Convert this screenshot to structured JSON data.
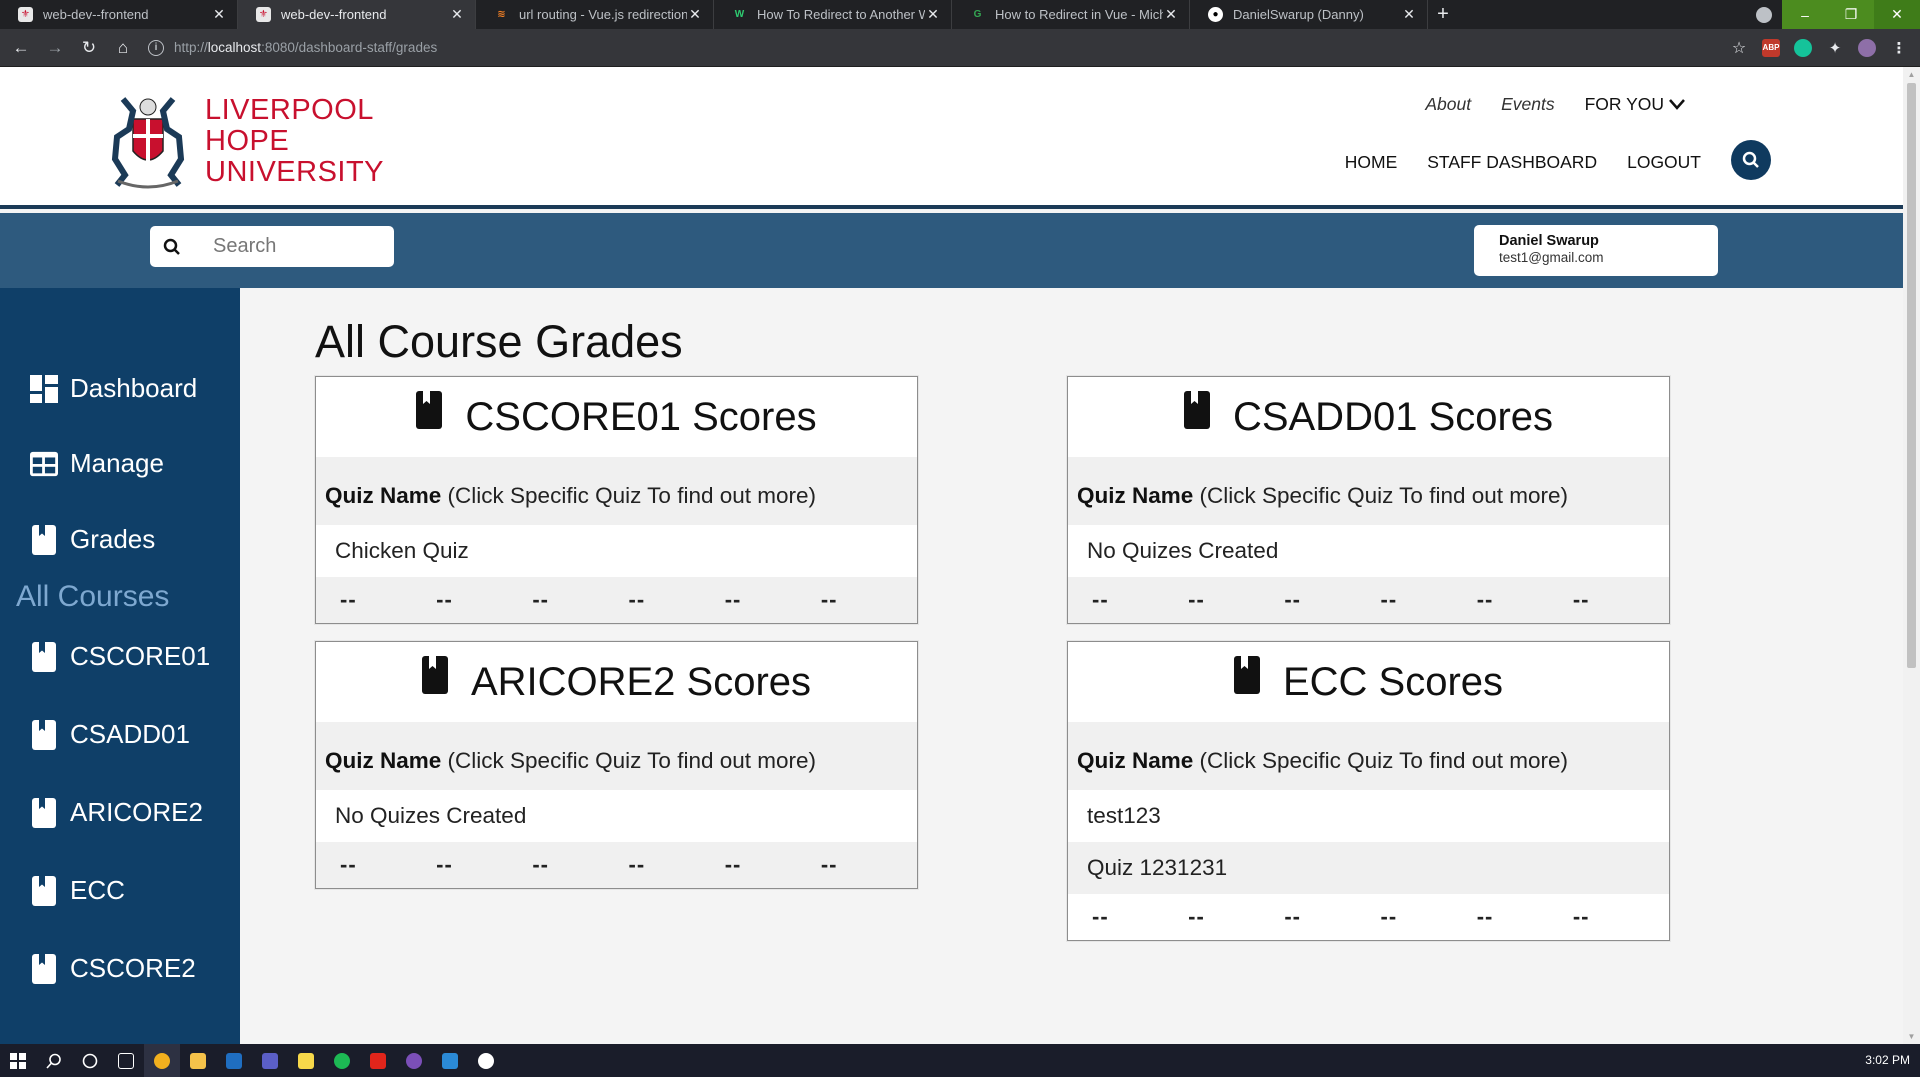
{
  "browser": {
    "tabs": [
      {
        "title": "web-dev--frontend",
        "active": false
      },
      {
        "title": "web-dev--frontend",
        "active": true
      },
      {
        "title": "url routing - Vue.js redirection to",
        "active": false
      },
      {
        "title": "How To Redirect to Another Web",
        "active": false
      },
      {
        "title": "How to Redirect in Vue - Michael",
        "active": false
      },
      {
        "title": "DanielSwarup (Danny)",
        "active": false
      }
    ],
    "url_scheme": "http://",
    "url_host": "localhost",
    "url_rest": ":8080/dashboard-staff/grades",
    "ext_abp": "ABP"
  },
  "header": {
    "logo_line1": "LIVERPOOL",
    "logo_line2": "HOPE",
    "logo_line3": "UNIVERSITY",
    "util_about": "About",
    "util_events": "Events",
    "util_foryou": "FOR YOU",
    "nav_home": "HOME",
    "nav_staff": "STAFF DASHBOARD",
    "nav_logout": "LOGOUT"
  },
  "band": {
    "search_placeholder": "Search",
    "user_name": "Daniel Swarup",
    "user_email": "test1@gmail.com"
  },
  "sidebar": {
    "dashboard": "Dashboard",
    "manage": "Manage",
    "grades": "Grades",
    "all_courses": "All Courses",
    "courses": [
      "CSCORE01",
      "CSADD01",
      "ARICORE2",
      "ECC",
      "CSCORE2"
    ]
  },
  "main": {
    "title": "All Course Grades",
    "quiz_name_label": "Quiz Name",
    "quiz_name_hint": "(Click Specific Quiz To find out more)",
    "dash": "--",
    "cards": [
      {
        "title": "CSCORE01 Scores",
        "quizzes": [
          "Chicken Quiz"
        ]
      },
      {
        "title": "CSADD01 Scores",
        "quizzes": [
          "No Quizes Created"
        ]
      },
      {
        "title": "ARICORE2 Scores",
        "quizzes": [
          "No Quizes Created"
        ]
      },
      {
        "title": "ECC Scores",
        "quizzes": [
          "test123",
          "Quiz 1231231"
        ]
      }
    ]
  },
  "taskbar": {
    "clock": "3:02 PM"
  },
  "colors": {
    "brand_red": "#c8102e",
    "navy": "#0f3f68",
    "band": "#2e5a7e"
  }
}
